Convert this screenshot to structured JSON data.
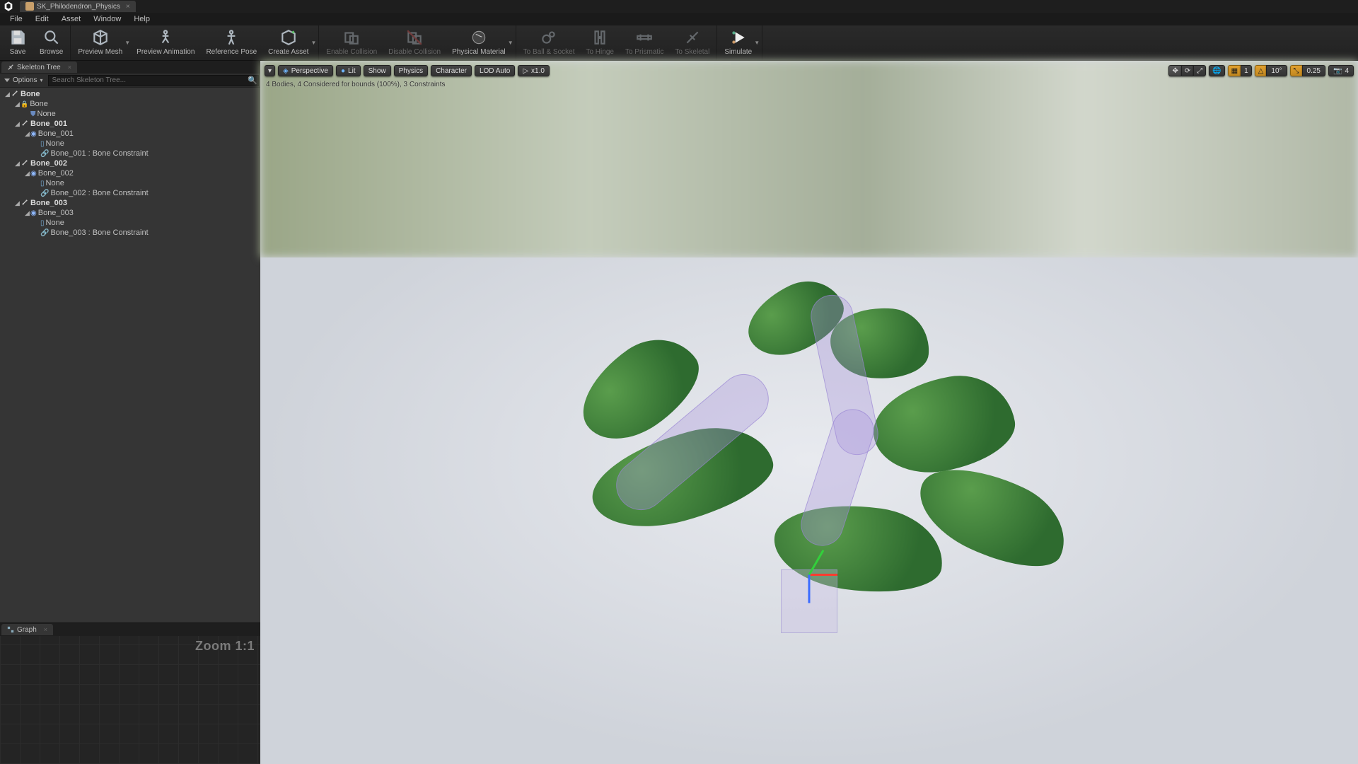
{
  "titlebar": {
    "doc_tab": "SK_Philodendron_Physics"
  },
  "menubar": [
    "File",
    "Edit",
    "Asset",
    "Window",
    "Help"
  ],
  "toolbar": {
    "groups": [
      {
        "items": [
          {
            "label": "Save",
            "icon": "save-icon"
          },
          {
            "label": "Browse",
            "icon": "browse-icon"
          }
        ]
      },
      {
        "items": [
          {
            "label": "Preview Mesh",
            "icon": "preview-mesh-icon",
            "arrow": true
          },
          {
            "label": "Preview Animation",
            "icon": "preview-anim-icon"
          },
          {
            "label": "Reference Pose",
            "icon": "refpose-icon"
          },
          {
            "label": "Create Asset",
            "icon": "create-asset-icon",
            "arrow": true
          }
        ]
      },
      {
        "items": [
          {
            "label": "Enable Collision",
            "icon": "enable-collision-icon",
            "disabled": true
          },
          {
            "label": "Disable Collision",
            "icon": "disable-collision-icon",
            "disabled": true
          },
          {
            "label": "Physical Material",
            "icon": "phys-material-icon",
            "arrow": true
          }
        ]
      },
      {
        "items": [
          {
            "label": "To Ball & Socket",
            "icon": "ballsocket-icon",
            "disabled": true
          },
          {
            "label": "To Hinge",
            "icon": "hinge-icon",
            "disabled": true
          },
          {
            "label": "To Prismatic",
            "icon": "prismatic-icon",
            "disabled": true
          },
          {
            "label": "To Skeletal",
            "icon": "skeletal-icon",
            "disabled": true
          }
        ]
      },
      {
        "items": [
          {
            "label": "Simulate",
            "icon": "simulate-icon",
            "arrow": true
          }
        ]
      }
    ]
  },
  "left_panel": {
    "tab": "Skeleton Tree",
    "options_label": "Options",
    "search_placeholder": "Search Skeleton Tree...",
    "tree": [
      {
        "d": 0,
        "exp": true,
        "kind": "bone",
        "bold": true,
        "label": "Bone"
      },
      {
        "d": 1,
        "exp": true,
        "kind": "lock",
        "label": "Bone"
      },
      {
        "d": 2,
        "kind": "shield",
        "label": "None"
      },
      {
        "d": 1,
        "exp": true,
        "kind": "bone",
        "bold": true,
        "label": "Bone_001"
      },
      {
        "d": 2,
        "exp": true,
        "kind": "sphere",
        "label": "Bone_001"
      },
      {
        "d": 3,
        "kind": "cap",
        "label": "None"
      },
      {
        "d": 3,
        "kind": "link",
        "label": "Bone_001 : Bone Constraint"
      },
      {
        "d": 1,
        "exp": true,
        "kind": "bone",
        "bold": true,
        "label": "Bone_002"
      },
      {
        "d": 2,
        "exp": true,
        "kind": "sphere",
        "label": "Bone_002"
      },
      {
        "d": 3,
        "kind": "cap",
        "label": "None"
      },
      {
        "d": 3,
        "kind": "link",
        "label": "Bone_002 : Bone Constraint"
      },
      {
        "d": 1,
        "exp": true,
        "kind": "bone",
        "bold": true,
        "label": "Bone_003"
      },
      {
        "d": 2,
        "exp": true,
        "kind": "sphere",
        "label": "Bone_003"
      },
      {
        "d": 3,
        "kind": "cap",
        "label": "None"
      },
      {
        "d": 3,
        "kind": "link",
        "label": "Bone_003 : Bone Constraint"
      }
    ]
  },
  "graph_panel": {
    "tab": "Graph",
    "zoom_label": "Zoom 1:1"
  },
  "viewport": {
    "left_btns": {
      "menu": "▾",
      "perspective": "Perspective",
      "lit": "Lit",
      "show": "Show",
      "physics": "Physics",
      "character": "Character",
      "lod": "LOD Auto",
      "speed": "x1.0"
    },
    "right_btns": {
      "angle": "10°",
      "snap": "0.25",
      "cam": "4"
    },
    "status": "4 Bodies, 4 Considered for bounds (100%), 3 Constraints"
  }
}
